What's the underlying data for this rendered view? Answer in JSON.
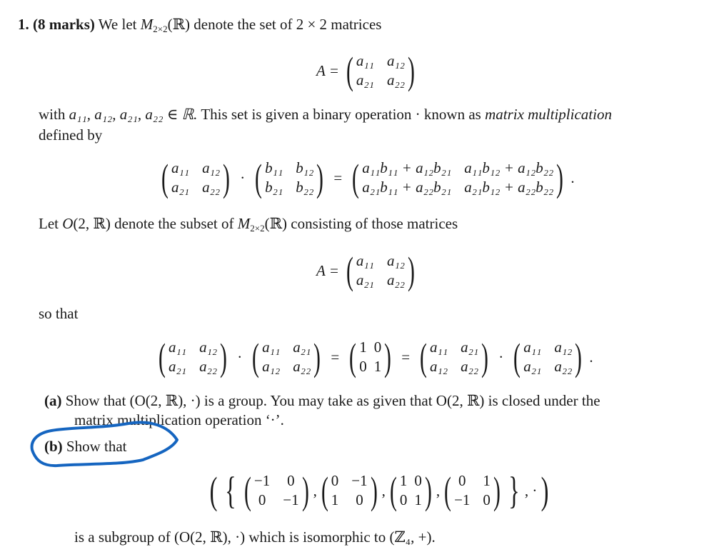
{
  "question": {
    "number": "1.",
    "marks": "(8 marks)",
    "intro": "We let",
    "intro_set": "M",
    "intro_set_sub": "2×2",
    "intro_rest": "(ℝ) denote the set of 2 × 2 matrices",
    "matrix_lhs": "A =",
    "matrix_A": [
      "a",
      "11",
      "a",
      "12",
      "a",
      "21",
      "a",
      "22"
    ],
    "line2_a": "with",
    "line2_vars": "a₁₁, a₁₂, a₂₁, a₂₂ ∈ ℝ.",
    "line2_b": "This set is given a binary operation · known as",
    "line2_em": "matrix multiplication",
    "line3": "defined by",
    "product": {
      "left": [
        "a₁₁",
        "a₁₂",
        "a₂₁",
        "a₂₂"
      ],
      "right": [
        "b₁₁",
        "b₁₂",
        "b₂₁",
        "b₂₂"
      ],
      "result": [
        "a₁₁b₁₁ + a₁₂b₂₁",
        "a₁₁b₁₂ + a₁₂b₂₂",
        "a₂₁b₁₁ + a₂₂b₂₁",
        "a₂₁b₁₂ + a₂₂b₂₂"
      ]
    },
    "line4_a": "Let",
    "line4_O": "O",
    "line4_b": "(2, ℝ) denote the subset of",
    "line4_M": "M",
    "line4_c": "(ℝ) consisting of those matrices",
    "so_that": "so that",
    "orth": {
      "A": [
        "a₁₁",
        "a₁₂",
        "a₂₁",
        "a₂₂"
      ],
      "AT": [
        "a₁₁",
        "a₂₁",
        "a₁₂",
        "a₂₂"
      ],
      "I": [
        "1",
        "0",
        "0",
        "1"
      ]
    },
    "part_a_label": "(a)",
    "part_a_text1": "Show that (O(2, ℝ), ·) is a group. You may take as given that O(2, ℝ) is closed under the",
    "part_a_text2": "matrix multiplication operation ‘·’.",
    "part_b_label": "(b)",
    "part_b_text": "Show that",
    "subgroup": [
      [
        "−1",
        "0",
        "0",
        "−1"
      ],
      [
        "0",
        "−1",
        "1",
        "0"
      ],
      [
        "1",
        "0",
        "0",
        "1"
      ],
      [
        "0",
        "1",
        "−1",
        "0"
      ]
    ],
    "conclusion": "is a subgroup of (O(2, ℝ), ·) which is isomorphic to (ℤ₄, +).",
    "annotation_color": "#1565c0"
  }
}
